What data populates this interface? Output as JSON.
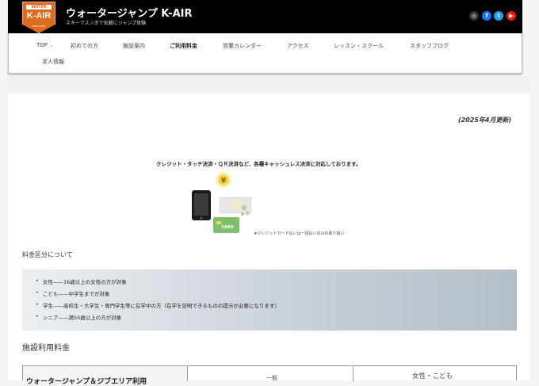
{
  "header": {
    "logo": {
      "top_text": "WATER JUMP",
      "main_text": "K-AIR",
      "bottom_text": "SINCE 1987"
    },
    "site_title": "ウォータージャンプ K-AIR",
    "tagline": "スキーでスノボで気軽にジャンプ体験",
    "social": [
      {
        "name": "instagram",
        "glyph": "◎",
        "color": "#333333"
      },
      {
        "name": "facebook",
        "glyph": "f",
        "color": "#1877f2"
      },
      {
        "name": "twitter",
        "glyph": "t",
        "color": "#1da1f2"
      },
      {
        "name": "youtube",
        "glyph": "▶",
        "color": "#e62117"
      }
    ]
  },
  "nav": {
    "items": [
      {
        "label": "TOP",
        "dropdown": "⌄"
      },
      {
        "label": "初めての方"
      },
      {
        "label": "施設案内"
      },
      {
        "label": "ご利用料金",
        "active": true
      },
      {
        "label": "営業カレンダー"
      },
      {
        "label": "アクセス"
      },
      {
        "label": "レッスン・スクール"
      },
      {
        "label": "スタッフブログ"
      },
      {
        "label": "求人情報"
      }
    ]
  },
  "main": {
    "updated": "(2025年4月更新)",
    "payment_notice": "クレジット・タッチ決済・ＱＲ決済など、各種キャッシュレス決済に対応しております。",
    "illustration": {
      "yen_symbol": "¥",
      "card_label": "CARD",
      "note": "★クレジットカード払いは一括払いのみの取り扱い"
    },
    "category_heading": "料金区分について",
    "categories": [
      "女性——16歳以上の女性の方が対象",
      "こども——中学生までが対象",
      "学生——高校生・大学生・専門学生等に在学中の方（在学を証明できるものの提示が必要になります）",
      "シニア——満50歳以上の方が対象"
    ],
    "facility_heading": "施設利用料金",
    "table_first_row": {
      "label": "ウォータージャンプ＆ジブエリア利用",
      "middle": "一般",
      "right": "女性・こども"
    }
  }
}
